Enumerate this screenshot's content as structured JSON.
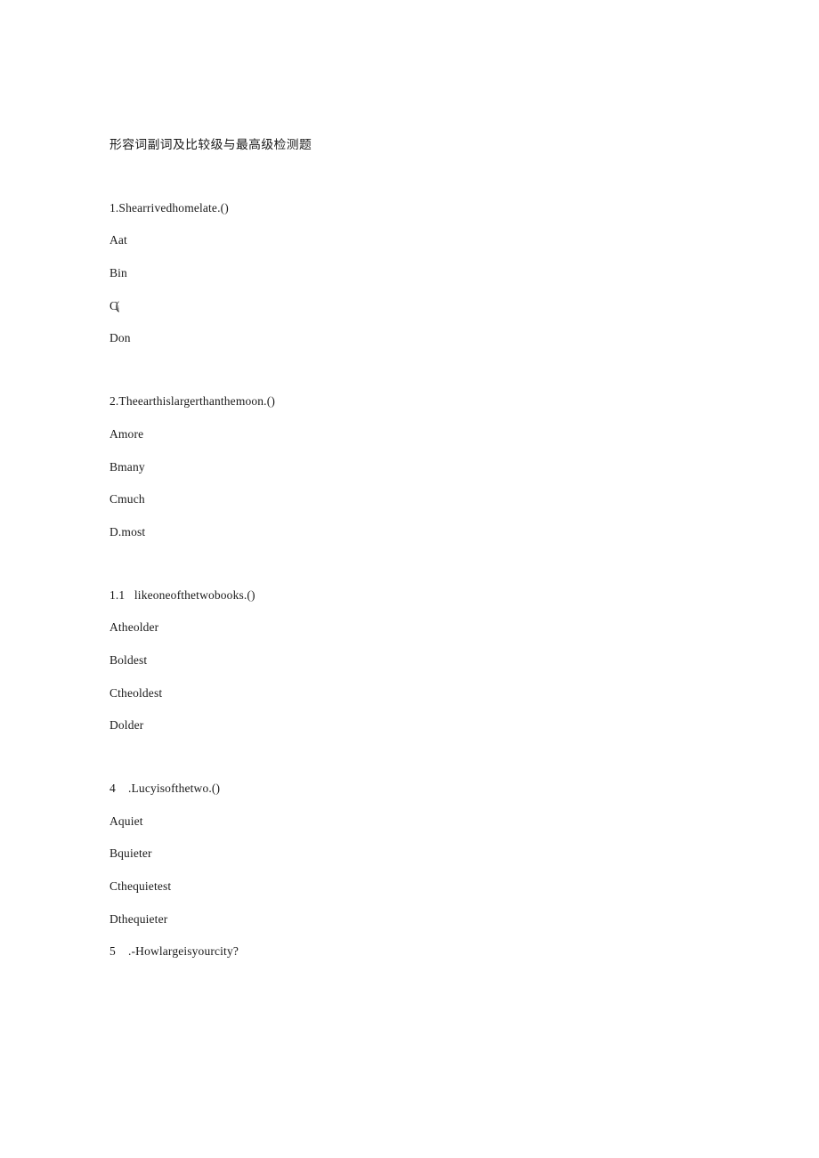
{
  "document": {
    "title": "形容词副词及比较级与最高级检测题",
    "background_color": "#ffffff",
    "text_color": "#1a1a1a"
  },
  "questions": [
    {
      "stem": "1.Shearrivedhomelate.()",
      "options": [
        "Aat",
        "Bin",
        "",
        "Don"
      ],
      "option_c_artifact": {
        "primary": "C(",
        "subscript": "i"
      }
    },
    {
      "stem": "2.Theearthislargerthanthemoon.()",
      "options": [
        "Amore",
        "Bmany",
        "Cmuch",
        "D.most"
      ]
    },
    {
      "stem": "1.1   likeoneofthetwobooks.()",
      "options": [
        "Atheolder",
        "Boldest",
        "Ctheoldest",
        "Dolder"
      ]
    },
    {
      "stem": "4    .Lucyisofthetwo.()",
      "options": [
        "Aquiet",
        "Bquieter",
        "Cthequietest",
        "Dthequieter"
      ]
    }
  ],
  "trailing_line": "5    .-Howlargeisyourcity?"
}
